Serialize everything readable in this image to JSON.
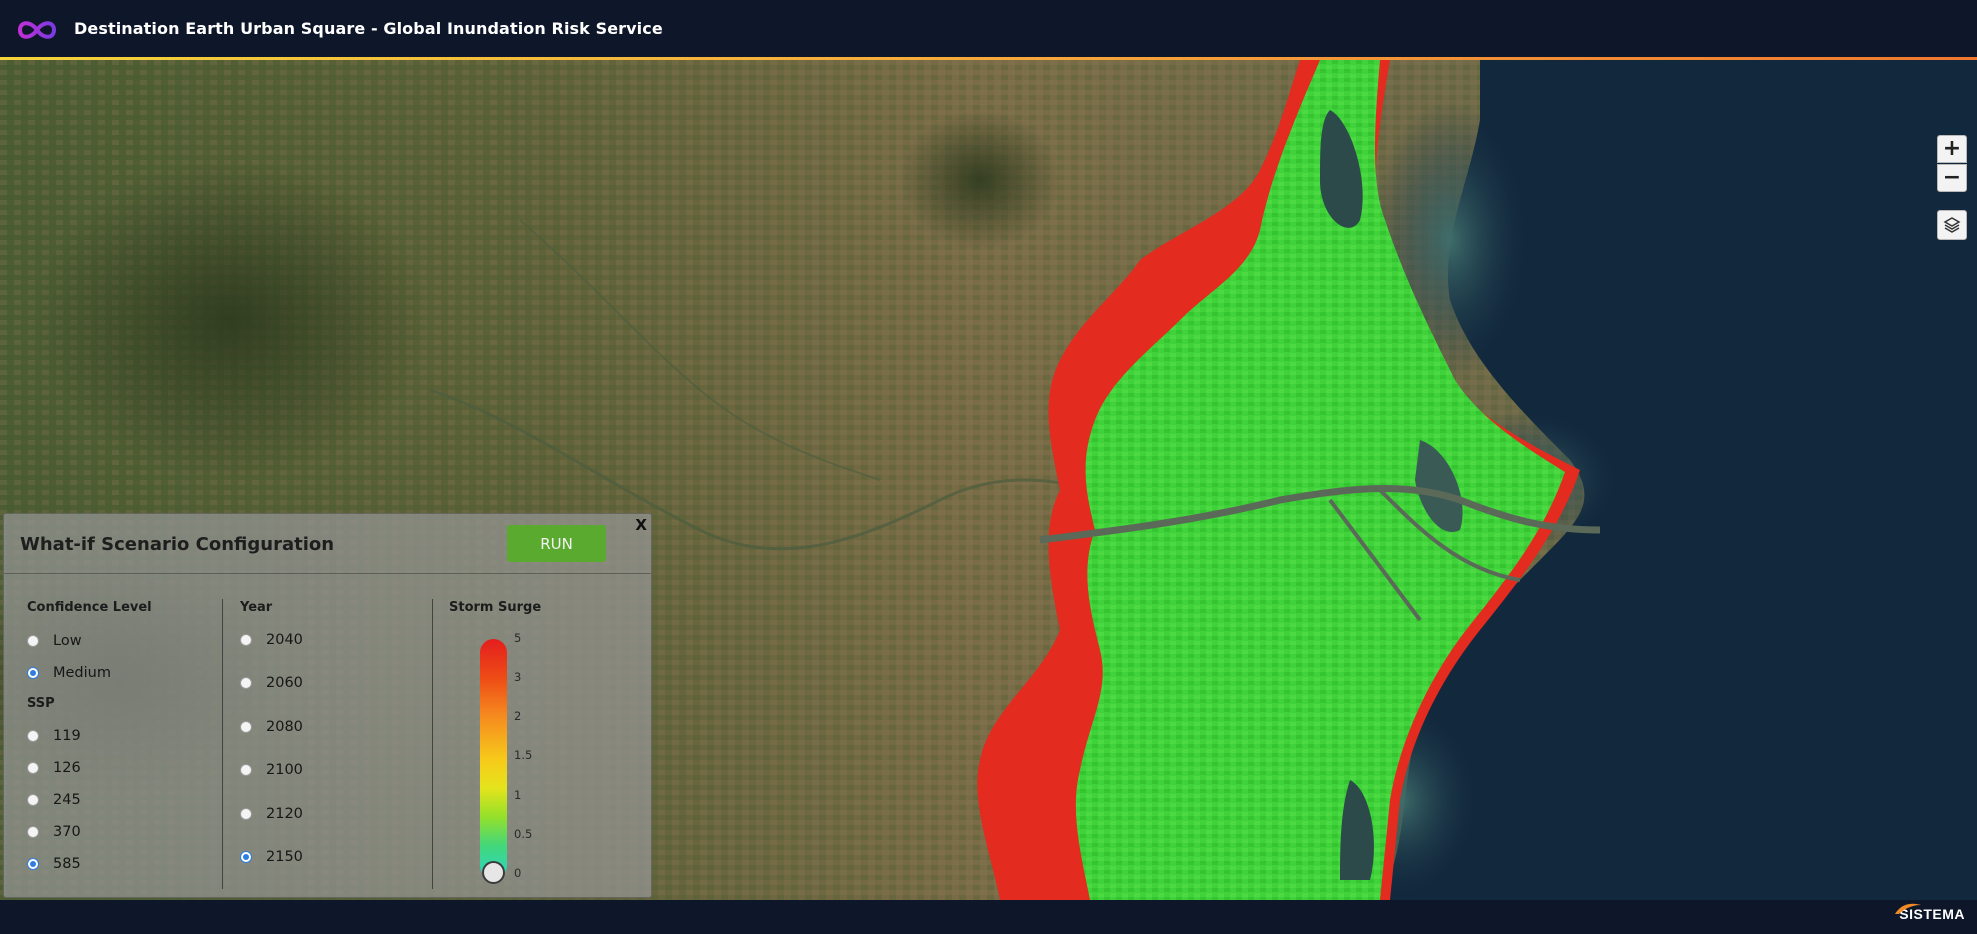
{
  "header": {
    "title": "Destination Earth Urban Square - Global Inundation Risk Service",
    "logo_icon": "infinity-logo-icon",
    "accent_gradient": [
      "#f5d33a",
      "#f6a43a",
      "#f0782f"
    ]
  },
  "map": {
    "zoom_in_label": "+",
    "zoom_out_label": "−",
    "layers_icon": "layers-icon",
    "flood_color": "#3fd23a",
    "risk_color": "#e32b1f",
    "sea_color": "#12283c"
  },
  "panel": {
    "title": "What-if Scenario Configuration",
    "run_label": "RUN",
    "close_label": "X",
    "run_color": "#5aaa2f",
    "confidence": {
      "label": "Confidence Level",
      "options": [
        {
          "label": "Low",
          "checked": false
        },
        {
          "label": "Medium",
          "checked": true
        }
      ]
    },
    "ssp": {
      "label": "SSP",
      "options": [
        {
          "label": "119",
          "checked": false
        },
        {
          "label": "126",
          "checked": false
        },
        {
          "label": "245",
          "checked": false
        },
        {
          "label": "370",
          "checked": false
        },
        {
          "label": "585",
          "checked": true
        }
      ]
    },
    "year": {
      "label": "Year",
      "options": [
        {
          "label": "2040",
          "checked": false
        },
        {
          "label": "2060",
          "checked": false
        },
        {
          "label": "2080",
          "checked": false
        },
        {
          "label": "2100",
          "checked": false
        },
        {
          "label": "2120",
          "checked": false
        },
        {
          "label": "2150",
          "checked": true
        }
      ]
    },
    "storm_surge": {
      "label": "Storm Surge",
      "ticks": [
        "5",
        "3",
        "2",
        "1.5",
        "1",
        "0.5",
        "0"
      ],
      "selected_value": "0"
    }
  },
  "footer": {
    "brand": "SISTEMA"
  }
}
